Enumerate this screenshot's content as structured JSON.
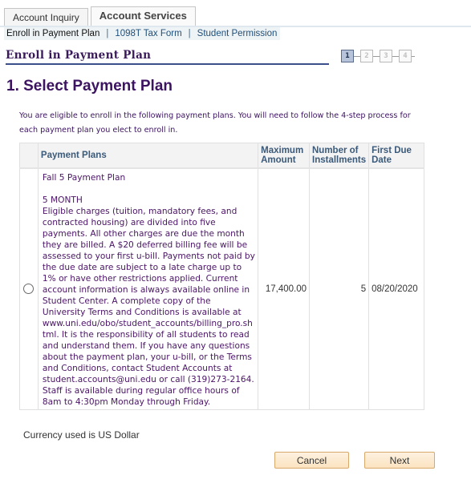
{
  "tabs": [
    {
      "label": "Account Inquiry",
      "active": false
    },
    {
      "label": "Account Services",
      "active": true
    }
  ],
  "subnav": {
    "current": "Enroll in Payment Plan",
    "separator": "|",
    "links": [
      "1098T Tax Form",
      "Student Permission"
    ]
  },
  "section_title": "Enroll in Payment Plan",
  "steps": {
    "labels": [
      "1",
      "2",
      "3",
      "4"
    ],
    "current": 1
  },
  "page_heading": "1. Select Payment Plan",
  "intro": "You are eligible to enroll in the following payment plans. You will need to follow the 4-step process for each payment plan you elect to enroll in.",
  "table": {
    "headers": {
      "plans": "Payment Plans",
      "max_amount": "Maximum Amount",
      "installments": "Number of Installments",
      "first_due": "First Due Date"
    },
    "rows": [
      {
        "selected": false,
        "plan_name": "Fall 5 Payment Plan",
        "plan_subtitle": "5  MONTH",
        "plan_description": "Eligible charges (tuition, mandatory fees, and contracted housing) are divided into five payments.  All other charges are due the month they are billed.  A $20 deferred billing fee will be assessed to your first u-bill. Payments not paid by the due date are subject to a late charge up to 1% or have other restrictions applied. Current account information is always available online in Student Center.  A complete copy of the University Terms and Conditions is available at www.uni.edu/obo/student_accounts/billing_pro.shtml. It is the responsibility of all students to read and understand them.  If you have any questions about the payment plan, your u-bill, or the Terms and Conditions, contact Student Accounts at student.accounts@uni.edu or call (319)273-2164.  Staff is available during regular office hours of 8am to 4:30pm Monday through Friday.",
        "max_amount": "17,400.00",
        "installments": "5",
        "first_due": "08/20/2020"
      }
    ]
  },
  "currency_note": "Currency used is US Dollar",
  "buttons": {
    "cancel": "Cancel",
    "next": "Next"
  }
}
